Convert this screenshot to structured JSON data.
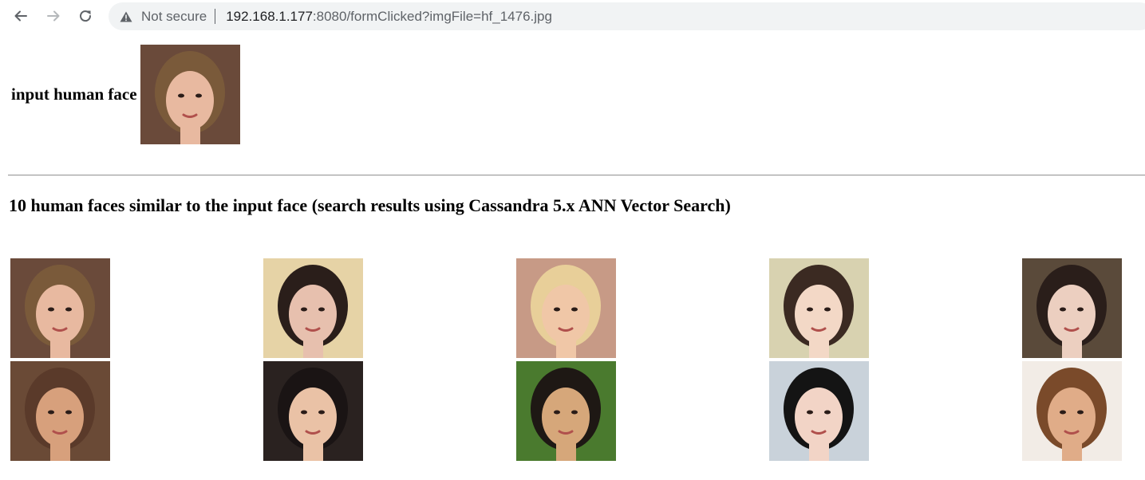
{
  "browser": {
    "security_label": "Not secure",
    "url_host": "192.168.1.177",
    "url_rest": ":8080/formClicked?imgFile=hf_1476.jpg"
  },
  "input_section": {
    "label": "input human face",
    "image": {
      "alt": "hf_1476.jpg",
      "bg": "#6a4a3a",
      "skin": "#e8b9a0",
      "hair": "#7a5a3a"
    }
  },
  "results_section": {
    "heading": "10 human faces similar to the input face (search results using Cassandra 5.x ANN Vector Search)",
    "results": [
      {
        "bg": "#6a4a3a",
        "skin": "#e8b9a0",
        "hair": "#7a5a3a"
      },
      {
        "bg": "#e6d3a6",
        "skin": "#e7c0ae",
        "hair": "#2a1e1a"
      },
      {
        "bg": "#c79a86",
        "skin": "#f0c7a7",
        "hair": "#e8cf99"
      },
      {
        "bg": "#d8d2b0",
        "skin": "#f3d8c6",
        "hair": "#3b2a22"
      },
      {
        "bg": "#5a4a3a",
        "skin": "#eccfc0",
        "hair": "#2a1e1a"
      },
      {
        "bg": "#6a4a36",
        "skin": "#d7a07c",
        "hair": "#5a3a2a"
      },
      {
        "bg": "#2a2220",
        "skin": "#eac2a6",
        "hair": "#1a1414"
      },
      {
        "bg": "#4a7a2e",
        "skin": "#d6a77a",
        "hair": "#1e1814"
      },
      {
        "bg": "#c9d2da",
        "skin": "#f2d4c6",
        "hair": "#141414"
      },
      {
        "bg": "#f2ece6",
        "skin": "#e0ac88",
        "hair": "#7a4a2a"
      }
    ]
  }
}
